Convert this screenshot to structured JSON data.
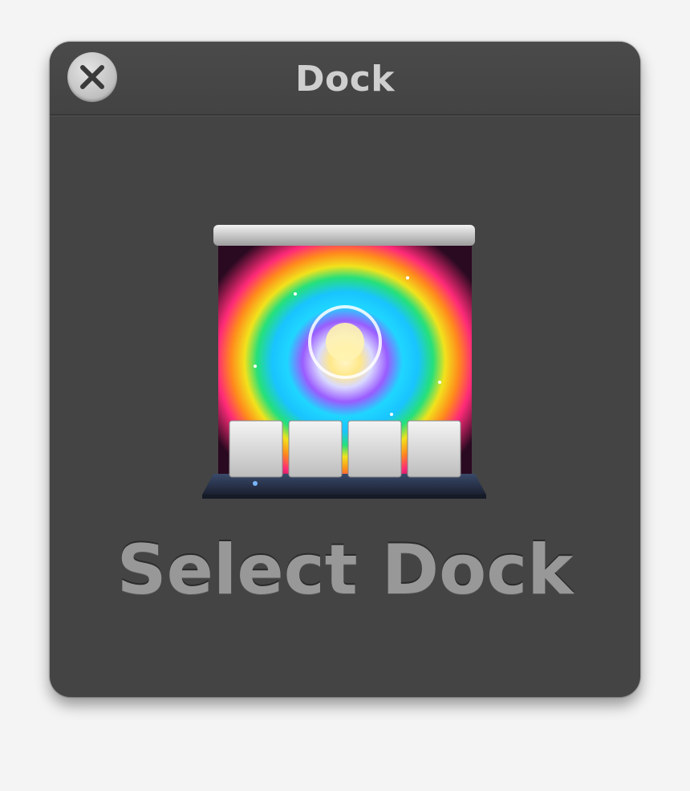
{
  "window": {
    "title": "Dock"
  },
  "main": {
    "action_label": "Select Dock"
  },
  "icons": {
    "close": "close-icon",
    "app": "dock-app-icon"
  },
  "colors": {
    "panel_bg": "#444444",
    "title_text": "#cfcfcf",
    "action_text": "#989898",
    "page_bg": "#f4f4f4"
  }
}
